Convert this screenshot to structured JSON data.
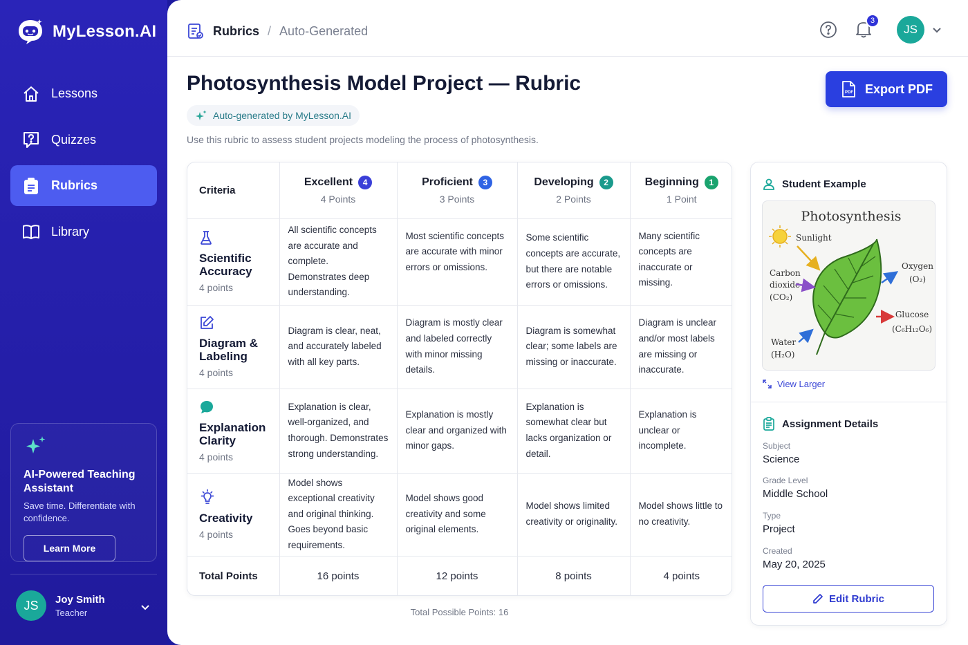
{
  "brand": {
    "name": "MyLesson.AI"
  },
  "sidebar": {
    "items": [
      {
        "label": "Lessons",
        "icon": "home-icon",
        "active": false
      },
      {
        "label": "Quizzes",
        "icon": "quiz-icon",
        "active": false
      },
      {
        "label": "Rubrics",
        "icon": "clipboard-icon",
        "active": true
      },
      {
        "label": "Library",
        "icon": "book-icon",
        "active": false
      }
    ],
    "promo": {
      "title": "AI-Powered Teaching Assistant",
      "text": "Save time. Differentiate with confidence.",
      "button": "Learn More"
    },
    "user": {
      "initials": "JS",
      "name": "Joy Smith",
      "role": "Teacher"
    }
  },
  "header": {
    "breadcrumb": [
      "Rubrics",
      "Auto-Generated"
    ],
    "separator": "/",
    "notifications": "3",
    "avatar_initials": "JS"
  },
  "page": {
    "title": "Photosynthesis Model Project — Rubric",
    "ai_badge": "Auto-generated by MyLesson.AI",
    "subtitle": "Use this rubric to assess student projects modeling the process of photosynthesis.",
    "export_label": "Export PDF"
  },
  "rubric": {
    "criteria_header": "Criteria",
    "levels": [
      {
        "name": "Excellent",
        "num": "4",
        "points": "4 Points",
        "color": "#3a3fd8"
      },
      {
        "name": "Proficient",
        "num": "3",
        "points": "3 Points",
        "color": "#2f63e4"
      },
      {
        "name": "Developing",
        "num": "2",
        "points": "2 Points",
        "color": "#1a9a8c"
      },
      {
        "name": "Beginning",
        "num": "1",
        "points": "1 Point",
        "color": "#1aa36e"
      }
    ],
    "criteria": [
      {
        "name": "Scientific Accuracy",
        "points": "4 points",
        "icon": "flask-icon",
        "cells": [
          "All scientific concepts are accurate and complete. Demonstrates deep understanding.",
          "Most scientific concepts are accurate with minor errors or omissions.",
          "Some scientific concepts are accurate, but there are notable errors or omissions.",
          "Many scientific concepts are inaccurate or missing."
        ]
      },
      {
        "name": "Diagram & Labeling",
        "points": "4 points",
        "icon": "edit-icon",
        "cells": [
          "Diagram is clear, neat, and accurately labeled with all key parts.",
          "Diagram is mostly clear and labeled correctly with minor missing details.",
          "Diagram is somewhat clear; some labels are missing or inaccurate.",
          "Diagram is unclear and/or most labels are missing or inaccurate."
        ]
      },
      {
        "name": "Explanation Clarity",
        "points": "4 points",
        "icon": "chat-icon",
        "cells": [
          "Explanation is clear, well-organized, and thorough. Demonstrates strong understanding.",
          "Explanation is mostly clear and organized with minor gaps.",
          "Explanation is somewhat clear but lacks organization or detail.",
          "Explanation is unclear or incomplete."
        ]
      },
      {
        "name": "Creativity",
        "points": "4 points",
        "icon": "lightbulb-icon",
        "cells": [
          "Model shows exceptional creativity and original thinking. Goes beyond basic requirements.",
          "Model shows good creativity and some original elements.",
          "Model shows limited creativity or originality.",
          "Model shows little to no creativity."
        ]
      }
    ],
    "total_label": "Total Points",
    "totals": [
      "16 points",
      "12 points",
      "8 points",
      "4 points"
    ],
    "total_possible": "Total Possible Points: 16"
  },
  "side": {
    "example_title": "Student Example",
    "drawing": {
      "title": "Photosynthesis",
      "sunlight": "Sunlight",
      "carbon": [
        "Carbon",
        "dioxide",
        "(CO₂)"
      ],
      "oxygen": [
        "Oxygen",
        "(O₂)"
      ],
      "glucose": [
        "Glucose",
        "(C₆H₁₂O₆)"
      ],
      "water": [
        "Water",
        "(H₂O)"
      ]
    },
    "view_larger": "View Larger",
    "details_title": "Assignment Details",
    "details": [
      {
        "label": "Subject",
        "value": "Science"
      },
      {
        "label": "Grade Level",
        "value": "Middle School"
      },
      {
        "label": "Type",
        "value": "Project"
      },
      {
        "label": "Created",
        "value": "May 20, 2025"
      }
    ],
    "edit_label": "Edit Rubric"
  }
}
